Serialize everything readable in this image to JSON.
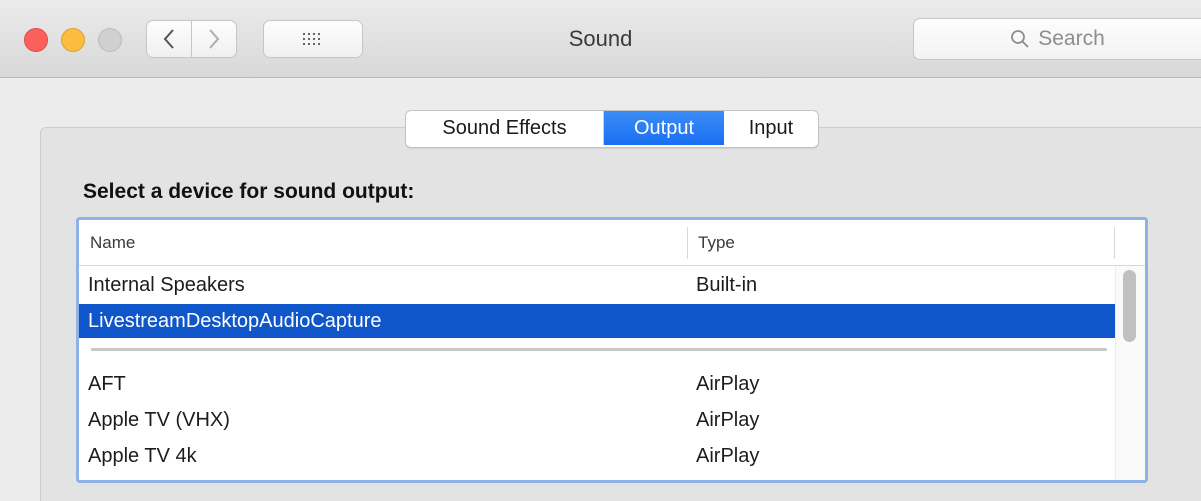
{
  "window": {
    "title": "Sound"
  },
  "toolbar": {
    "search_placeholder": "Search"
  },
  "tabs": [
    {
      "label": "Sound Effects",
      "selected": false
    },
    {
      "label": "Output",
      "selected": true
    },
    {
      "label": "Input",
      "selected": false
    }
  ],
  "output": {
    "heading": "Select a device for sound output:",
    "columns": {
      "name": "Name",
      "type": "Type"
    },
    "devices": [
      {
        "name": "Internal Speakers",
        "type": "Built-in",
        "selected": false
      },
      {
        "name": "LivestreamDesktopAudioCapture",
        "type": "",
        "selected": true
      },
      {
        "name": "AFT",
        "type": "AirPlay",
        "selected": false
      },
      {
        "name": "Apple TV (VHX)",
        "type": "AirPlay",
        "selected": false
      },
      {
        "name": "Apple TV 4k",
        "type": "AirPlay",
        "selected": false
      }
    ]
  },
  "colors": {
    "selection": "#0e56c9",
    "accent": "#1a6ff2",
    "close": "#fc605c",
    "minimize": "#fdbc40",
    "zoom_disabled": "#d0d0d0"
  }
}
